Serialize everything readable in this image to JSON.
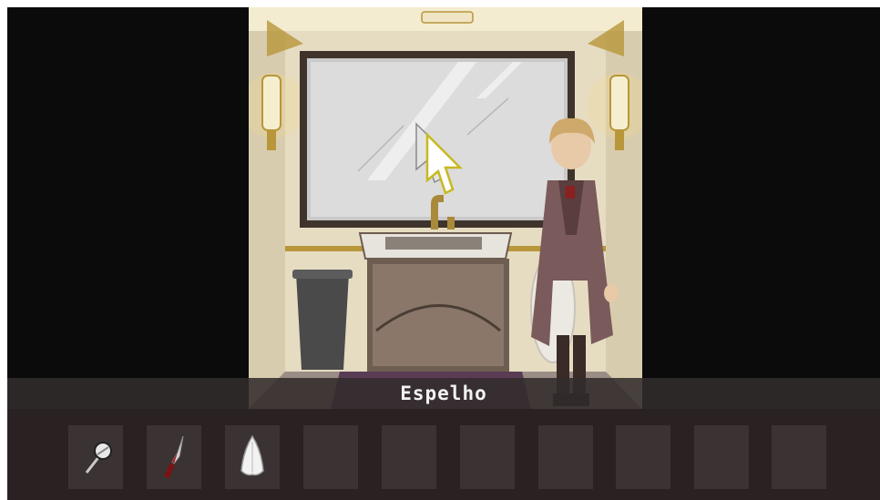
{
  "hotspot": {
    "label": "Espelho"
  },
  "inventory": {
    "slots": [
      {
        "item": "magnifying-glass",
        "filled": true
      },
      {
        "item": "bloody-knife",
        "filled": true
      },
      {
        "item": "white-cloth",
        "filled": true
      },
      {
        "item": "",
        "filled": false
      },
      {
        "item": "",
        "filled": false
      },
      {
        "item": "",
        "filled": false
      },
      {
        "item": "",
        "filled": false
      },
      {
        "item": "",
        "filled": false
      },
      {
        "item": "",
        "filled": false
      },
      {
        "item": "",
        "filled": false
      }
    ]
  },
  "cursor": {
    "icon": "arrow-cursor-icon"
  },
  "colors": {
    "background": "#0b0b0b",
    "caption_bar": "#322c2c",
    "inventory_bar": "#2a2222",
    "slot": "#3b3333",
    "caption_text": "#f2f2f2",
    "gold_trim": "#b8963a"
  }
}
